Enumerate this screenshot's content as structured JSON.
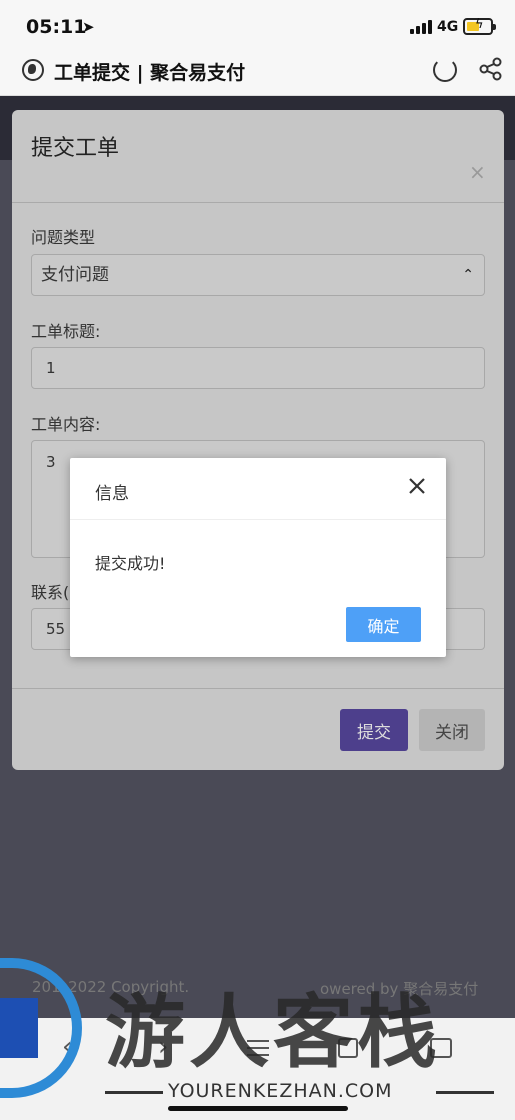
{
  "status_bar": {
    "time": "05:11",
    "network": "4G"
  },
  "browser": {
    "page_title": "工单提交 | 聚合易支付"
  },
  "modal": {
    "title": "提交工单",
    "close_glyph": "×",
    "type_label": "问题类型",
    "type_value": "支付问题",
    "title_label": "工单标题:",
    "title_value": "1",
    "content_label": "工单内容:",
    "content_value": "3",
    "contact_label": "联系(",
    "contact_value": "55",
    "submit_label": "提交",
    "close_label": "关闭"
  },
  "dialog": {
    "title": "信息",
    "message": "提交成功!",
    "ok_label": "确定"
  },
  "footer": {
    "copyright": "201–2022 Copyright.",
    "powered": "owered by 聚合易支付"
  },
  "watermark": {
    "text": "游人客栈",
    "url": "YOURENKEZHAN.COM"
  },
  "colors": {
    "primary": "#4d3f8c",
    "dialog_button": "#4ea0f7",
    "overlay": "#4a4a56"
  }
}
